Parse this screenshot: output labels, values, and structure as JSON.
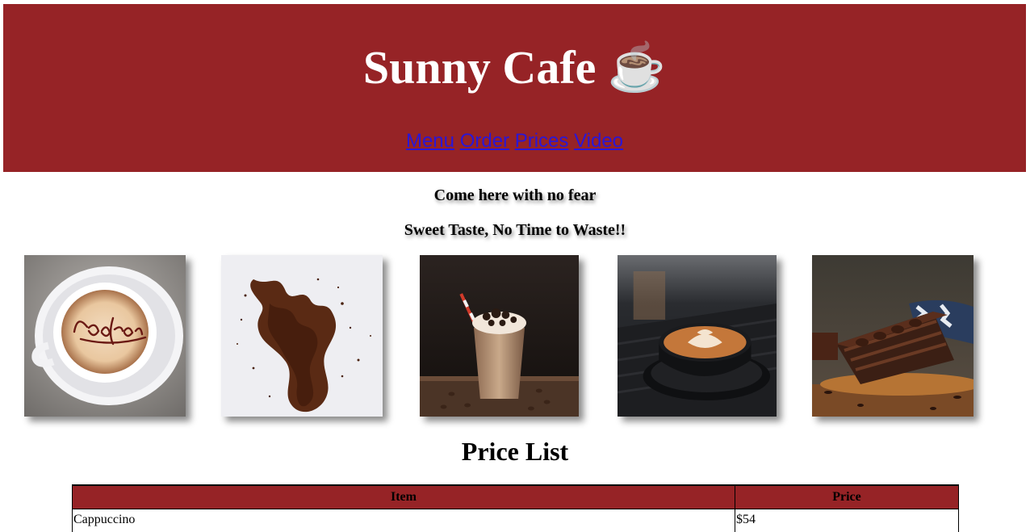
{
  "header": {
    "title": "Sunny Cafe ☕",
    "nav": [
      "Menu",
      "Order",
      "Prices",
      "Video"
    ],
    "background": "#962326"
  },
  "taglines": [
    "Come here with no fear",
    "Sweet Taste, No Time to Waste!!"
  ],
  "gallery": [
    {
      "icon": "cappuccino-cup-photo"
    },
    {
      "icon": "coffee-grounds-photo"
    },
    {
      "icon": "iced-frappe-photo"
    },
    {
      "icon": "latte-art-cup-photo"
    },
    {
      "icon": "chocolate-cake-slice-photo"
    }
  ],
  "price_list": {
    "title": "Price List",
    "columns": [
      "Item",
      "Price"
    ],
    "rows": [
      {
        "item": "Cappuccino",
        "price": "$54"
      }
    ]
  }
}
